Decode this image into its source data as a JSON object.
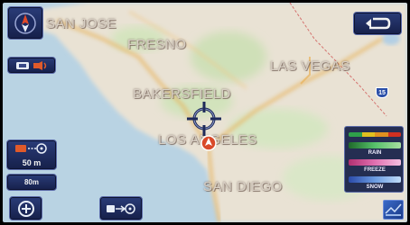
{
  "map": {
    "cities": [
      {
        "id": "san-jose",
        "label": "SAN JOSE"
      },
      {
        "id": "fresno",
        "label": "FRESNO"
      },
      {
        "id": "las-vegas",
        "label": "LAS VEGAS"
      },
      {
        "id": "bakersfield",
        "label": "BAKERSFIELD"
      },
      {
        "id": "los-angeles",
        "label": "LOS ANGELES"
      },
      {
        "id": "san-diego",
        "label": "SAN DIEGO"
      }
    ],
    "highway_shield": "15",
    "colors": {
      "water": "#b9d3e3",
      "land": "#e9e2d4",
      "park": "#cfe0b8",
      "road": "#e8b25a"
    }
  },
  "controls": {
    "scale_value": "50 m",
    "scale_unit": "80m",
    "legend": {
      "colors": [
        "#2fa04a",
        "#e0c020",
        "#e09020",
        "#d03020"
      ],
      "items": [
        "RAIN",
        "FREEZE",
        "SNOW"
      ]
    }
  },
  "icons": {
    "compass": "compass-icon",
    "back": "return-arrow-icon",
    "layer": "map-layer-icon",
    "scale": "scale-icon",
    "zoom": "zoom-icon",
    "route": "route-icon",
    "crosshair": "crosshair-icon",
    "position": "position-marker-icon",
    "corner": "corner-map-icon"
  }
}
